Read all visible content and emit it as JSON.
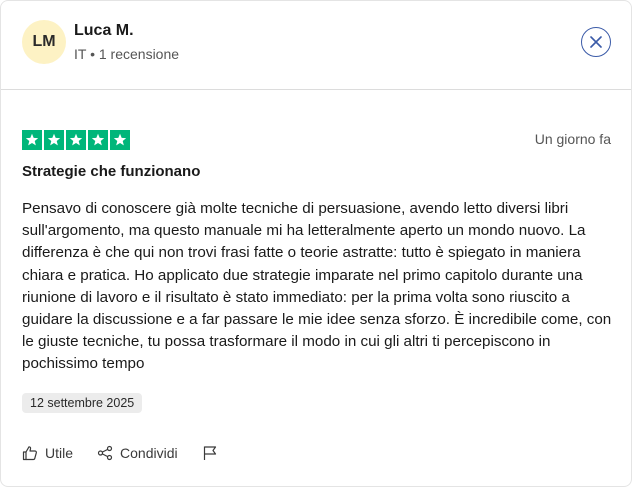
{
  "reviewer": {
    "initials": "LM",
    "name": "Luca M.",
    "meta": "IT • 1 recensione"
  },
  "review": {
    "rating": 5,
    "date_relative": "Un giorno fa",
    "title": "Strategie che funzionano",
    "body": "Pensavo di conoscere già molte tecniche di persuasione, avendo letto diversi libri sull'argomento, ma questo manuale mi ha letteralmente aperto un mondo nuovo. La differenza è che qui non trovi frasi fatte o teorie astratte: tutto è spiegato in maniera chiara e pratica. Ho applicato due strategie imparate nel primo capitolo durante una riunione di lavoro e il risultato è stato immediato: per la prima volta sono riuscito a guidare la discussione e a far passare le mie idee senza sforzo. È incredibile come, con le giuste tecniche, tu possa trasformare il modo in cui gli altri ti percepiscono in pochissimo tempo",
    "date_experience": "12 settembre 2025"
  },
  "actions": {
    "useful_label": "Utile",
    "share_label": "Condividi"
  },
  "colors": {
    "star_green": "#00b67a",
    "avatar_bg": "#fdf2c4",
    "close_blue": "#3b5ba8"
  },
  "icons": [
    "close-icon",
    "star-icon",
    "thumbs-up-icon",
    "share-icon",
    "flag-icon"
  ]
}
